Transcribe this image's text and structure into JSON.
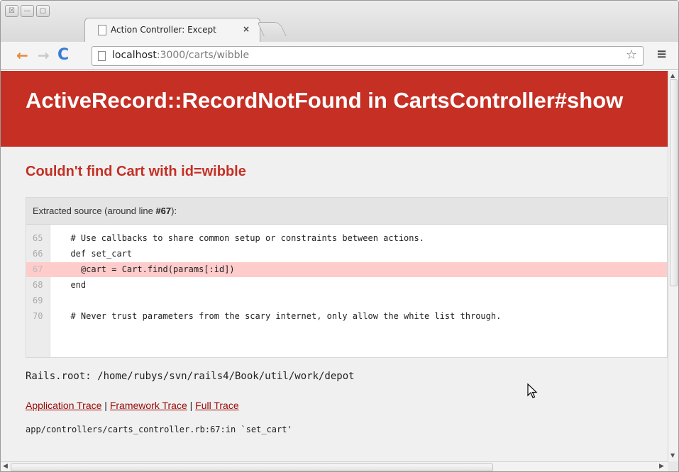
{
  "window": {
    "buttons": [
      "☒",
      "—",
      "▢"
    ]
  },
  "tab": {
    "title": "Action Controller: Except",
    "close": "×"
  },
  "toolbar": {
    "back": "←",
    "forward": "→",
    "reload": "C",
    "url_host": "localhost",
    "url_rest": ":3000/carts/wibble",
    "star": "☆",
    "menu": "≡"
  },
  "page": {
    "error_title": "ActiveRecord::RecordNotFound in CartsController#show",
    "error_message": "Couldn't find Cart with id=wibble",
    "source_header_prefix": "Extracted source (around line ",
    "source_header_line": "#67",
    "source_header_suffix": "):",
    "code": [
      {
        "line": "65",
        "text": "  # Use callbacks to share common setup or constraints between actions.",
        "highlight": false
      },
      {
        "line": "66",
        "text": "  def set_cart",
        "highlight": false
      },
      {
        "line": "67",
        "text": "    @cart = Cart.find(params[:id])",
        "highlight": true
      },
      {
        "line": "68",
        "text": "  end",
        "highlight": false
      },
      {
        "line": "69",
        "text": "",
        "highlight": false
      },
      {
        "line": "70",
        "text": "  # Never trust parameters from the scary internet, only allow the white list through.",
        "highlight": false
      }
    ],
    "rails_root": "Rails.root: /home/rubys/svn/rails4/Book/util/work/depot",
    "trace_links": [
      "Application Trace",
      "Framework Trace",
      "Full Trace"
    ],
    "trace_separator": " | ",
    "trace_line": "app/controllers/carts_controller.rb:67:in `set_cart'"
  },
  "colors": {
    "error_red": "#c52f24",
    "highlight_row": "#ffcccc",
    "link": "#980905"
  }
}
